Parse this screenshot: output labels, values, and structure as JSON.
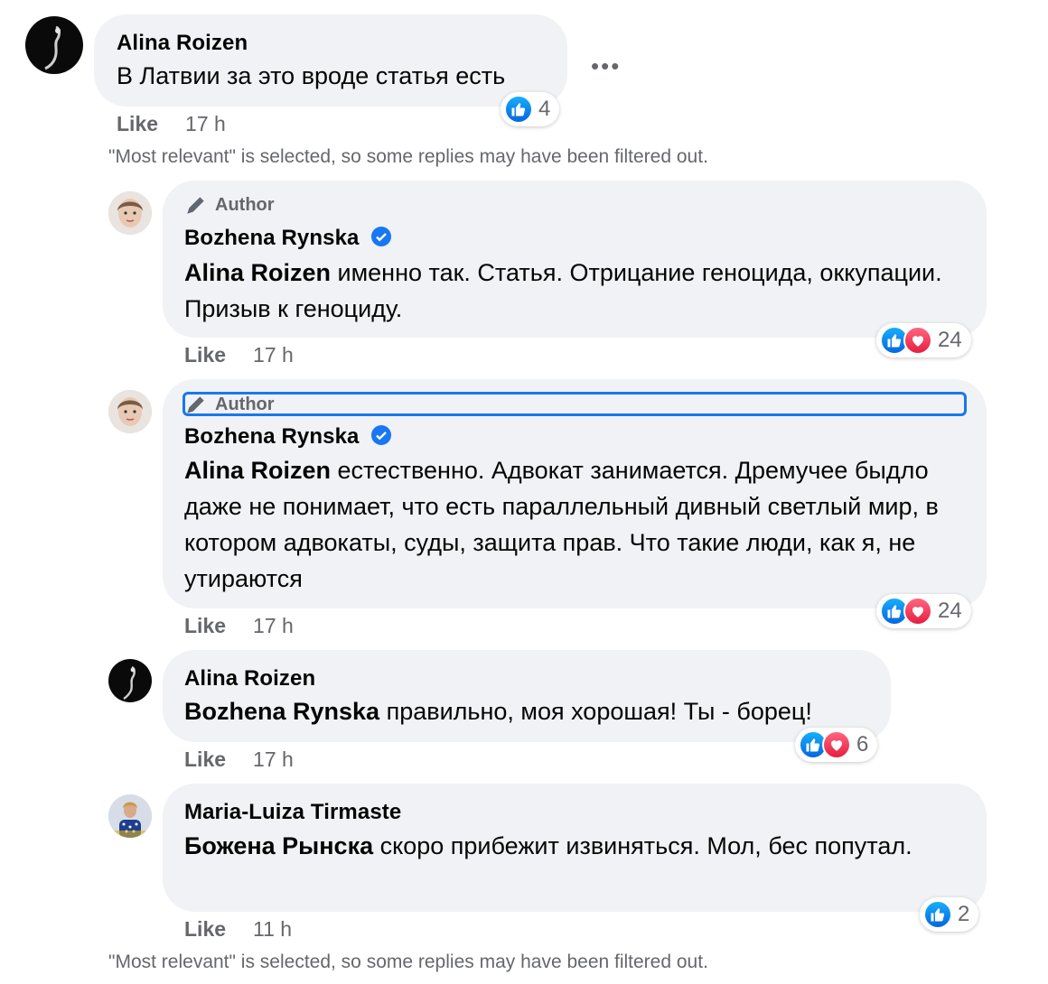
{
  "colors": {
    "accent": "#1877f2",
    "bubble": "#f0f2f5",
    "secondary_text": "#65676b"
  },
  "top_comment": {
    "author": "Alina Roizen",
    "text": "В Латвии за это вроде статья есть",
    "like_label": "Like",
    "time": "17 h",
    "reaction_count": "4",
    "more_icon": "more-options-icon"
  },
  "notice_1": "\"Most relevant\" is selected, so some replies may have been filtered out.",
  "replies": [
    {
      "author_tag": "Author",
      "author": "Bozhena Rynska",
      "mention": "Alina Roizen",
      "text": " именно так. Статья. Отрицание геноцида, оккупации. Призыв к геноциду.",
      "like_label": "Like",
      "time": "17 h",
      "reaction_count": "24"
    },
    {
      "author_tag": "Author",
      "author": "Bozhena Rynska",
      "mention": "Alina Roizen",
      "text": " естественно. Адвокат занимается. Дремучее быдло даже не понимает, что есть параллельный дивный светлый мир, в котором адвокаты, суды, защита прав. Что такие люди, как я, не утираются",
      "like_label": "Like",
      "time": "17 h",
      "reaction_count": "24"
    },
    {
      "author": "Alina Roizen",
      "mention": "Bozhena Rynska",
      "text": " правильно, моя хорошая! Ты - борец!",
      "like_label": "Like",
      "time": "17 h",
      "reaction_count": "6"
    },
    {
      "author": "Maria-Luiza Tirmaste",
      "mention": "Божена Рынска",
      "text": " скоро прибежит извиняться. Мол, бес попутал.",
      "like_label": "Like",
      "time": "11 h",
      "reaction_count": "2"
    }
  ],
  "notice_2": "\"Most relevant\" is selected, so some replies may have been filtered out."
}
